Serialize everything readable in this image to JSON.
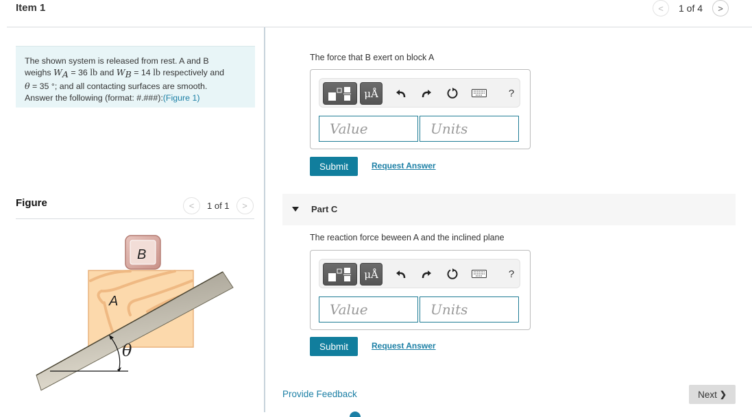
{
  "header": {
    "title": "Item 1",
    "pager": {
      "text": "1 of 4",
      "prev_icon": "chevron-left-icon",
      "next_icon": "chevron-right-icon",
      "prev_glyph": "<",
      "next_glyph": ">"
    }
  },
  "intro": {
    "line1": "The shown system is released from rest.  A and B",
    "weighs": "weighs ",
    "wa_sym": "W",
    "wa_sub": "A",
    "wa_eq": " = 36 ",
    "unit_lb": "lb",
    "and_text": " and ",
    "wb_sym": "W",
    "wb_sub": "B",
    "wb_eq": " = 14 ",
    "respectively": " respectively and",
    "theta_sym": "θ",
    "theta_eq": " = 35 °; and all contacting surfaces are smooth.",
    "answer_text": "Answer the following (format: #.###):",
    "figure_link": "(Figure 1)"
  },
  "figure": {
    "heading": "Figure",
    "pager": {
      "text": "1 of 1",
      "prev_glyph": "<",
      "next_glyph": ">"
    },
    "labels": {
      "block_a": "A",
      "block_b": "B",
      "angle": "θ"
    }
  },
  "parts": [
    {
      "question": "The force that B exert on block A",
      "value_placeholder": "Value",
      "units_placeholder": "Units",
      "submit_label": "Submit",
      "request_label": "Request Answer"
    },
    {
      "label": "Part C",
      "question": "The reaction force beween A and the inclined plane",
      "value_placeholder": "Value",
      "units_placeholder": "Units",
      "submit_label": "Submit",
      "request_label": "Request Answer"
    }
  ],
  "toolbar": {
    "units_glyph": "μÅ",
    "help_glyph": "?",
    "icons": [
      "templates-icon",
      "units-icon",
      "undo-icon",
      "redo-icon",
      "reset-icon",
      "keyboard-icon",
      "help-icon"
    ]
  },
  "footer": {
    "feedback_label": "Provide Feedback",
    "next_label": "Next",
    "next_glyph": "❯"
  },
  "colors": {
    "accent": "#117e9d",
    "link": "#1b7fa5",
    "intro_bg": "#e8f5f7",
    "next_bg": "#dcdcdc"
  }
}
